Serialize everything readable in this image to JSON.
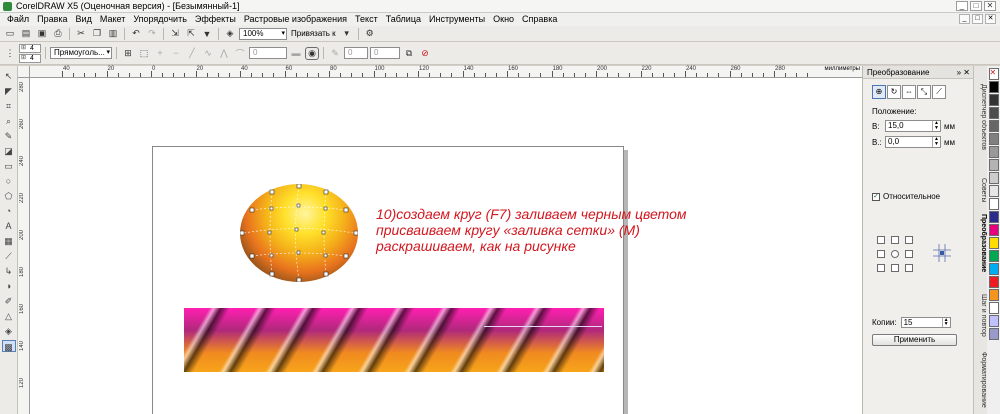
{
  "window": {
    "title": "CorelDRAW X5 (Оценочная версия) - [Безымянный-1]",
    "controls": [
      "_",
      "□",
      "✕"
    ]
  },
  "menu": {
    "items": [
      "Файл",
      "Правка",
      "Вид",
      "Макет",
      "Упорядочить",
      "Эффекты",
      "Растровые изображения",
      "Текст",
      "Таблица",
      "Инструменты",
      "Окно",
      "Справка"
    ],
    "doc_controls": [
      "_",
      "□",
      "✕"
    ]
  },
  "standard_toolbar": {
    "zoom_value": "100%",
    "snap_label": "Привязать к"
  },
  "property_bar": {
    "width_value": "4",
    "height_value": "4",
    "shape_combo": "Прямоуголь...",
    "field_a": "0",
    "field_b": "0",
    "field_c": "0"
  },
  "ruler": {
    "h_ticks": [
      "40",
      "20",
      "0",
      "20",
      "40",
      "60",
      "80",
      "100",
      "120",
      "140",
      "160",
      "180",
      "200",
      "220",
      "240",
      "260",
      "280"
    ],
    "units": "миллиметры",
    "v_ticks": [
      "280",
      "260",
      "240",
      "220",
      "200",
      "180",
      "160",
      "140",
      "120"
    ]
  },
  "canvas": {
    "annotation_line1": "10)создаем круг (F7) заливаем черным цветом",
    "annotation_line2": "присваиваем кругу «заливка сетки» (M)",
    "annotation_line3": "раскрашиваем, как на рисунке"
  },
  "docker": {
    "title": "Преобразование",
    "position_label": "Положение:",
    "h_label": "В:",
    "h_value": "15,0",
    "v_label": "В.:",
    "v_value": "0,0",
    "unit": "мм",
    "relative_label": "Относительное",
    "copies_label": "Копии:",
    "copies_value": "15",
    "apply_label": "Применить"
  },
  "dock_strip": {
    "tabs": [
      "Диспетчер объектов",
      "Советы",
      "Преобразование",
      "Шаг и повтор",
      "Форматирование"
    ]
  },
  "palette": {
    "colors": [
      "#000000",
      "#333333",
      "#4d4d4d",
      "#666666",
      "#808080",
      "#999999",
      "#b3b3b3",
      "#cccccc",
      "#e6e6e6",
      "#ffffff",
      "#2b2b8c",
      "#e6007e",
      "#ffdd00",
      "#00a650",
      "#00aeef",
      "#ed1c24",
      "#f7941d",
      "#ffffff",
      "#c0c0ff",
      "#9999cc"
    ]
  }
}
